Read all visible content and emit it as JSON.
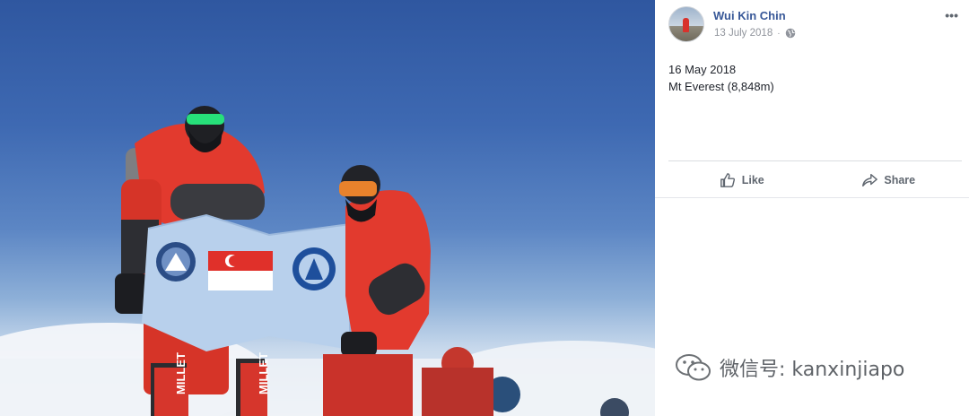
{
  "post": {
    "author": "Wui Kin Chin",
    "date": "13 July 2018",
    "separator": "·",
    "more_label": "•••",
    "text_line1": "16 May 2018",
    "text_line2": "Mt Everest (8,848m)"
  },
  "actions": {
    "like_label": "Like",
    "share_label": "Share"
  },
  "watermark": {
    "text": "微信号: kanxinjiapo"
  },
  "photo": {
    "flag_text_left": "MILLET",
    "flag_text_right": "MILLET"
  },
  "colors": {
    "link_blue": "#385898",
    "meta_grey": "#90949c",
    "action_grey": "#606770",
    "suit_red": "#e23a2e"
  }
}
